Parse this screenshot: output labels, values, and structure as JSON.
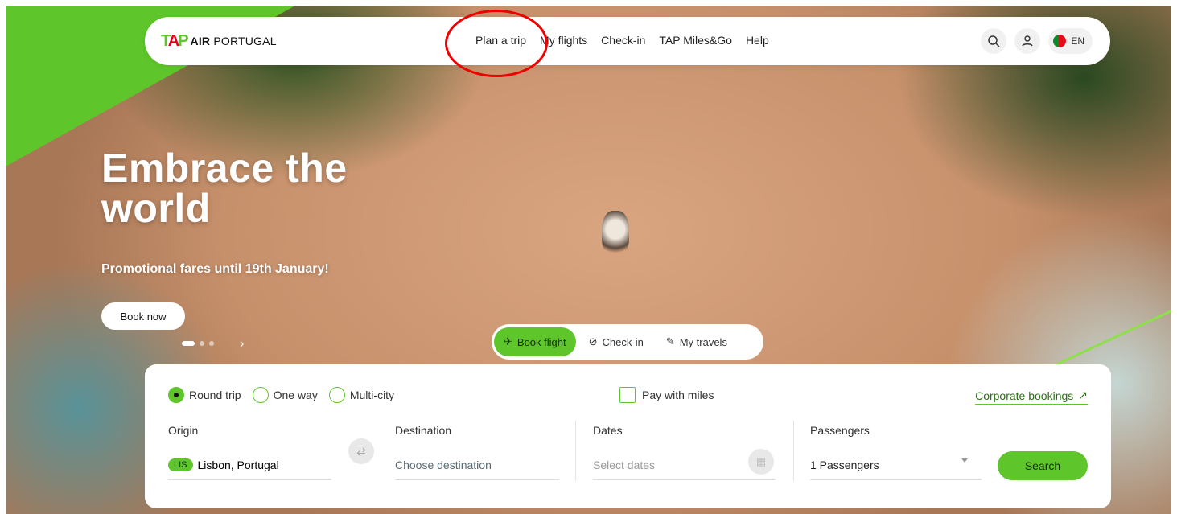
{
  "brand": {
    "mark": "TAP",
    "name_bold": "AIR",
    "name_rest": "PORTUGAL"
  },
  "nav": {
    "items": [
      "Plan a trip",
      "My flights",
      "Check-in",
      "TAP Miles&Go",
      "Help"
    ],
    "lang": "EN",
    "icons": [
      "search-icon",
      "user-icon",
      "portugal-flag-icon"
    ]
  },
  "hero": {
    "headline_line1": "Embrace the",
    "headline_line2": "world",
    "promo": "Promotional fares until 19th January!",
    "cta": "Book now"
  },
  "booking_tabs": [
    "Book flight",
    "Check-in",
    "My travels"
  ],
  "booking": {
    "trip_types": [
      "Round trip",
      "One way",
      "Multi-city"
    ],
    "selected_trip_type": "Round trip",
    "pay_with_miles": "Pay with miles",
    "corporate": "Corporate bookings",
    "origin_label": "Origin",
    "origin_code": "LIS",
    "origin_value": "Lisbon, Portugal",
    "destination_label": "Destination",
    "destination_placeholder": "Choose destination",
    "dates_label": "Dates",
    "dates_placeholder": "Select dates",
    "passengers_label": "Passengers",
    "passengers_value": "1 Passengers",
    "search": "Search"
  },
  "colors": {
    "brand_green": "#5ec62a",
    "brand_red": "#e3001b",
    "annotation_red": "#e00"
  }
}
